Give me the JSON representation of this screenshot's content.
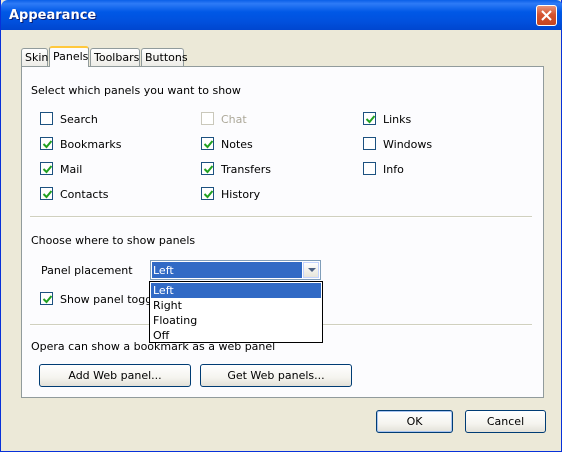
{
  "window": {
    "title": "Appearance"
  },
  "tabs": [
    {
      "label": "Skin",
      "active": false
    },
    {
      "label": "Panels",
      "active": true
    },
    {
      "label": "Toolbars",
      "active": false
    },
    {
      "label": "Buttons",
      "active": false
    }
  ],
  "panels_section": {
    "heading": "Select which panels you want to show",
    "checkboxes": [
      {
        "label": "Search",
        "checked": false,
        "enabled": true
      },
      {
        "label": "Bookmarks",
        "checked": true,
        "enabled": true
      },
      {
        "label": "Mail",
        "checked": true,
        "enabled": true
      },
      {
        "label": "Contacts",
        "checked": true,
        "enabled": true
      },
      {
        "label": "Chat",
        "checked": false,
        "enabled": false
      },
      {
        "label": "Notes",
        "checked": true,
        "enabled": true
      },
      {
        "label": "Transfers",
        "checked": true,
        "enabled": true
      },
      {
        "label": "History",
        "checked": true,
        "enabled": true
      },
      {
        "label": "Links",
        "checked": true,
        "enabled": true
      },
      {
        "label": "Windows",
        "checked": false,
        "enabled": true
      },
      {
        "label": "Info",
        "checked": false,
        "enabled": true
      }
    ]
  },
  "placement_section": {
    "heading": "Choose where to show panels",
    "placement_label": "Panel placement",
    "placement_value": "Left",
    "placement_options": [
      "Left",
      "Right",
      "Floating",
      "Off"
    ],
    "toggle_label": "Show panel toggle",
    "toggle_checked": true
  },
  "web_section": {
    "heading": "Opera can show a bookmark as a web panel",
    "add_button": "Add Web panel...",
    "get_button": "Get Web panels..."
  },
  "footer": {
    "ok_label": "OK",
    "cancel_label": "Cancel"
  },
  "colors": {
    "titlebar": "#0058E6",
    "selection": "#316AC5",
    "dialog_bg": "#ECE9D8",
    "close_button": "#D5532F"
  }
}
